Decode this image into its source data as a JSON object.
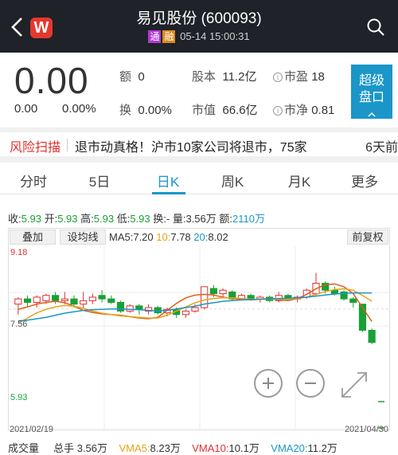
{
  "header": {
    "title": "易见股份 (600093)",
    "logo_glyph": "W",
    "tags": [
      "通",
      "融"
    ],
    "datetime": "05-14 15:00:31",
    "icons": [
      "back-arrow-icon",
      "app-logo-icon",
      "search-icon"
    ]
  },
  "quote": {
    "price": "0.00",
    "change": "0.00",
    "change_pct": "0.00%",
    "amount_label": "额",
    "amount_value": "0",
    "turnover_label": "换",
    "turnover_value": "0.00%",
    "equity_label": "股本",
    "equity_value": "11.2亿",
    "mcap_label": "市值",
    "mcap_value": "66.6亿",
    "pe_label": "市盈",
    "pe_value": "18",
    "pb_label": "市净",
    "pb_value": "0.81",
    "super_button": "超级\n盘口"
  },
  "risk": {
    "label": "风险扫描",
    "text": "退市动真格！沪市10家公司将退市，75家",
    "time": "6天前"
  },
  "tabs": [
    "分时",
    "5日",
    "日K",
    "周K",
    "月K",
    "更多"
  ],
  "active_tab": 2,
  "ohlc": {
    "close_label": "收:",
    "close": "5.93",
    "open_label": "开:",
    "open": "5.93",
    "high_label": "高:",
    "high": "5.93",
    "low_label": "低:",
    "low": "5.93",
    "turn_label": "换:",
    "turn": "-",
    "vol_label": "量:",
    "vol": "3.56万",
    "amt_label": "额:",
    "amt": "2110万"
  },
  "chart_controls": {
    "overlay": "叠加",
    "set_ma": "设均线",
    "adjust": "前复权"
  },
  "ma": {
    "ma5_label": "MA5:",
    "ma5": "7.20",
    "ma10_label": "10:",
    "ma10": "7.78",
    "ma20_label": "20:",
    "ma20": "8.02"
  },
  "axis": {
    "high": "9.18",
    "mid": "7.56",
    "low": "5.93"
  },
  "dates": {
    "start": "2021/02/19",
    "end": "2021/04/30"
  },
  "volume": {
    "label": "成交量",
    "total_label": "总手",
    "total": "3.56万",
    "vma5_label": "VMA5:",
    "vma5": "8.23万",
    "vma10_label": "VMA10:",
    "vma10": "10.1万",
    "vma20_label": "VMA20:",
    "vma20": "11.2万"
  },
  "colors": {
    "up": "#e03030",
    "down": "#19a035",
    "ma5": "#e05a1c",
    "ma10": "#e8a317",
    "ma20": "#1a96c8",
    "accent": "#1a96c8"
  },
  "chart_data": {
    "type": "candlestick",
    "ylim": [
      5.93,
      9.18
    ],
    "ma_series": [
      {
        "name": "MA5",
        "values": [
          7.55,
          7.62,
          7.7,
          7.75,
          7.78,
          7.74,
          7.64,
          7.52,
          7.46,
          7.42,
          7.4,
          7.38,
          7.34,
          7.3,
          7.28,
          7.32,
          7.52,
          7.72,
          7.88,
          7.96,
          7.98,
          7.96,
          7.9,
          7.86,
          7.84,
          7.82,
          7.84,
          7.86,
          7.82,
          7.8,
          7.86,
          7.98,
          8.14,
          8.26,
          8.28,
          8.2,
          8.0,
          7.6,
          7.2
        ]
      },
      {
        "name": "10",
        "values": [
          7.15,
          7.3,
          7.45,
          7.55,
          7.62,
          7.66,
          7.64,
          7.58,
          7.5,
          7.44,
          7.4,
          7.36,
          7.34,
          7.32,
          7.3,
          7.3,
          7.38,
          7.5,
          7.62,
          7.74,
          7.82,
          7.86,
          7.88,
          7.88,
          7.86,
          7.84,
          7.84,
          7.84,
          7.84,
          7.84,
          7.86,
          7.9,
          7.98,
          8.06,
          8.12,
          8.14,
          8.1,
          7.95,
          7.78
        ]
      },
      {
        "name": "20",
        "values": [
          7.22,
          7.24,
          7.28,
          7.32,
          7.38,
          7.44,
          7.48,
          7.52,
          7.54,
          7.55,
          7.56,
          7.56,
          7.55,
          7.54,
          7.52,
          7.5,
          7.52,
          7.56,
          7.6,
          7.64,
          7.7,
          7.74,
          7.78,
          7.8,
          7.82,
          7.83,
          7.84,
          7.85,
          7.86,
          7.87,
          7.88,
          7.9,
          7.93,
          7.96,
          7.99,
          8.01,
          8.02,
          8.02,
          8.02
        ]
      }
    ],
    "candles": [
      [
        7.7,
        7.85,
        7.4,
        7.9
      ],
      [
        7.85,
        7.75,
        7.6,
        7.95
      ],
      [
        7.75,
        7.9,
        7.6,
        7.95
      ],
      [
        7.8,
        7.95,
        7.7,
        8.0
      ],
      [
        7.95,
        7.8,
        7.7,
        8.05
      ],
      [
        7.8,
        7.85,
        7.7,
        8.05
      ],
      [
        7.85,
        7.7,
        7.6,
        7.95
      ],
      [
        7.7,
        7.8,
        7.6,
        8.05
      ],
      [
        7.8,
        7.9,
        7.7,
        8.0
      ],
      [
        7.95,
        7.85,
        7.75,
        8.1
      ],
      [
        7.85,
        7.75,
        7.7,
        7.95
      ],
      [
        7.75,
        7.5,
        7.45,
        7.8
      ],
      [
        7.5,
        7.65,
        7.45,
        7.7
      ],
      [
        7.65,
        7.55,
        7.4,
        7.7
      ],
      [
        7.5,
        7.6,
        7.4,
        7.7
      ],
      [
        7.6,
        7.45,
        7.4,
        7.65
      ],
      [
        7.45,
        7.55,
        7.35,
        7.6
      ],
      [
        7.55,
        7.4,
        7.3,
        7.6
      ],
      [
        7.4,
        7.5,
        7.3,
        7.55
      ],
      [
        7.5,
        7.6,
        7.45,
        7.7
      ],
      [
        7.6,
        8.2,
        7.55,
        8.2
      ],
      [
        8.15,
        8.0,
        7.9,
        8.25
      ],
      [
        8.0,
        8.1,
        7.9,
        8.15
      ],
      [
        8.05,
        7.85,
        7.8,
        8.1
      ],
      [
        7.85,
        7.95,
        7.8,
        8.0
      ],
      [
        7.95,
        7.85,
        7.8,
        8.0
      ],
      [
        7.85,
        7.9,
        7.75,
        7.95
      ],
      [
        7.9,
        7.8,
        7.75,
        7.95
      ],
      [
        7.8,
        7.95,
        7.75,
        8.05
      ],
      [
        7.95,
        7.85,
        7.8,
        8.0
      ],
      [
        7.85,
        7.9,
        7.75,
        7.95
      ],
      [
        7.9,
        8.1,
        7.85,
        8.15
      ],
      [
        8.0,
        8.3,
        7.95,
        8.6
      ],
      [
        8.3,
        8.1,
        8.0,
        8.35
      ],
      [
        8.1,
        8.0,
        7.95,
        8.2
      ],
      [
        8.05,
        7.85,
        7.8,
        8.1
      ],
      [
        7.85,
        7.75,
        7.6,
        7.9
      ],
      [
        7.7,
        6.95,
        6.9,
        7.7
      ],
      [
        6.95,
        6.6,
        6.55,
        7.0
      ]
    ]
  }
}
